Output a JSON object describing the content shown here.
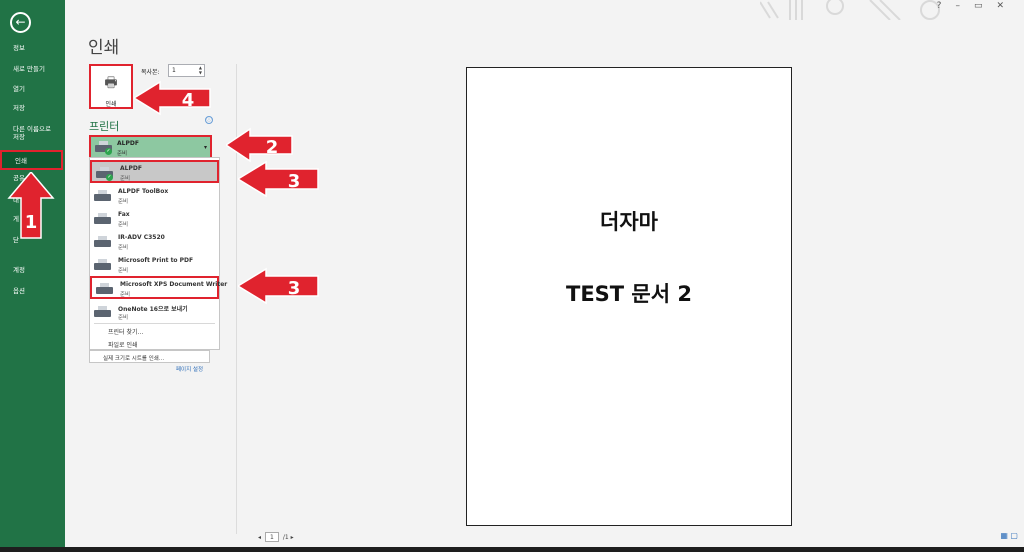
{
  "nav": {
    "back_icon": "back-arrow-icon",
    "items": [
      "정보",
      "새로 만들기",
      "열기",
      "저장",
      "다른 이름으로\n저장",
      "인쇄",
      "공유",
      "계정",
      "옵션"
    ],
    "partial_hidden": [
      "내",
      "게",
      "닫"
    ]
  },
  "page": {
    "title": "인쇄"
  },
  "print": {
    "button_label": "인쇄",
    "copies_label": "복사본:",
    "copies_value": "1"
  },
  "printer": {
    "section_label": "프린터",
    "info_icon": "ⓘ",
    "selected_name": "ALPDF",
    "selected_status": "준비",
    "list": [
      {
        "name": "ALPDF",
        "status": "준비"
      },
      {
        "name": "ALPDF ToolBox",
        "status": "준비"
      },
      {
        "name": "Fax",
        "status": "준비"
      },
      {
        "name": "IR-ADV C3520",
        "status": "준비"
      },
      {
        "name": "Microsoft Print to PDF",
        "status": "준비"
      },
      {
        "name": "Microsoft XPS Document Writer",
        "status": "준비"
      },
      {
        "name": "OneNote 16으로 보내기",
        "status": "준비"
      }
    ],
    "find_printer": "프린터 찾기...",
    "print_to_file": "파일로 인쇄"
  },
  "settings": {
    "scale_label": "실제 크기로 시트를 인쇄...",
    "page_setup": "페이지 설정"
  },
  "preview": {
    "line1": "더자마",
    "line2": "TEST 문서 2"
  },
  "pager": {
    "current": "1",
    "total": "/1"
  },
  "annotations": [
    "1",
    "2",
    "3",
    "3",
    "4"
  ],
  "colors": {
    "accent": "#217346",
    "annotation": "#e0232e"
  }
}
